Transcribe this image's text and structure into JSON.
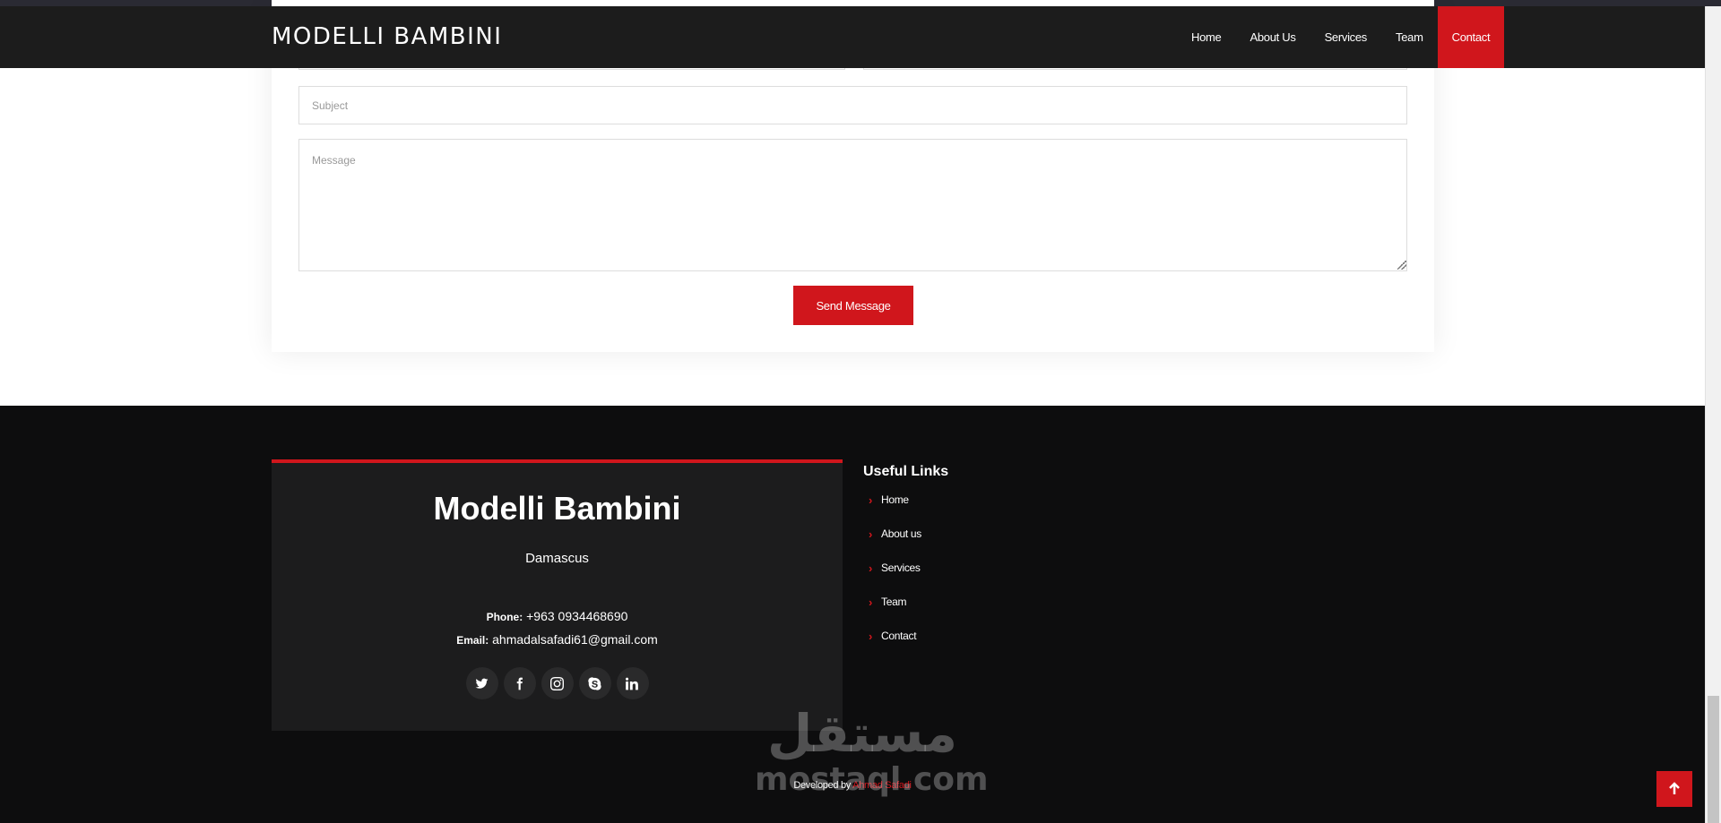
{
  "header": {
    "logo": "MODELLI BAMBINI",
    "nav": [
      {
        "label": "Home"
      },
      {
        "label": "About Us"
      },
      {
        "label": "Services"
      },
      {
        "label": "Team"
      },
      {
        "label": "Contact",
        "active": true
      }
    ]
  },
  "form": {
    "subject_placeholder": "Subject",
    "message_placeholder": "Message",
    "submit_label": "Send Message"
  },
  "footer": {
    "brand": "Modelli Bambini",
    "city": "Damascus",
    "phone_label": "Phone:",
    "phone": "+963 0934468690",
    "email_label": "Email:",
    "email": "ahmadalsafadi61@gmail.com",
    "socials": [
      "twitter-icon",
      "facebook-icon",
      "instagram-icon",
      "skype-icon",
      "linkedin-icon"
    ],
    "links_title": "Useful Links",
    "links": [
      {
        "label": "Home"
      },
      {
        "label": "About us"
      },
      {
        "label": "Services"
      },
      {
        "label": "Team"
      },
      {
        "label": "Contact"
      }
    ],
    "developed_by": "Developed by",
    "developer": "Ahmad Safadi"
  },
  "watermark": {
    "arabic": "مستقل",
    "latin": "mostaql.com"
  },
  "colors": {
    "accent": "#d0161c",
    "header_bg": "#1c1c1c",
    "footer_bg": "#0d0d0e",
    "card_bg": "#1c1c1d"
  }
}
